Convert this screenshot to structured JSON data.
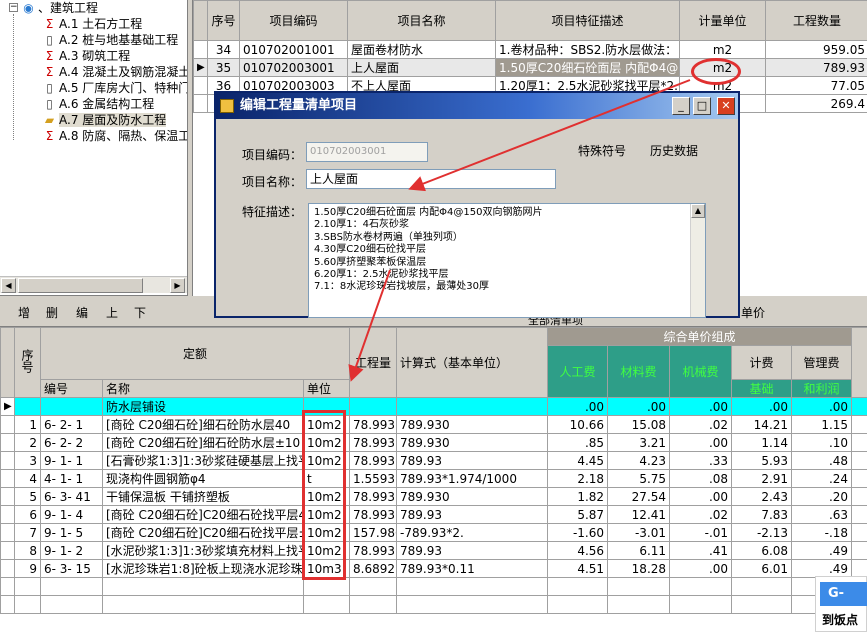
{
  "tree": {
    "root_label": "、建筑工程",
    "items": [
      {
        "icon": "sigma",
        "label": "A.1 土石方工程"
      },
      {
        "icon": "doc",
        "label": "A.2 桩与地基基础工程"
      },
      {
        "icon": "sigma",
        "label": "A.3 砌筑工程"
      },
      {
        "icon": "sigma",
        "label": "A.4 混凝土及钢筋混凝土"
      },
      {
        "icon": "doc",
        "label": "A.5 厂库房大门、特种门"
      },
      {
        "icon": "doc",
        "label": "A.6 金属结构工程"
      },
      {
        "icon": "folder",
        "label": "A.7 屋面及防水工程"
      },
      {
        "icon": "sigma",
        "label": "A.8 防腐、隔热、保温工"
      }
    ]
  },
  "toolbar": {
    "add": "增",
    "delete": "删",
    "edit": "编",
    "up": "上",
    "down": "下"
  },
  "top_grid": {
    "headers": [
      "序号",
      "项目编码",
      "项目名称",
      "项目特征描述",
      "计量单位",
      "工程数量"
    ],
    "rows": [
      {
        "seq": "34",
        "code": "010702001001",
        "name": "屋面卷材防水",
        "desc": "1.卷材品种：SBS2.防水层做法：",
        "unit": "m2",
        "qty": "959.05"
      },
      {
        "seq": "35",
        "code": "010702003001",
        "name": "上人屋面",
        "desc": "1.50厚C20细石砼面层 内配Φ4@1",
        "unit": "m2",
        "qty": "789.93"
      },
      {
        "seq": "36",
        "code": "010702003003",
        "name": "不上人屋面",
        "desc": "1.20厚1：2.5水泥砂浆找平层*2.(",
        "unit": "m2",
        "qty": "77.05"
      },
      {
        "seq": "",
        "code": "",
        "name": "",
        "desc": "",
        "unit": "",
        "qty": "269.4"
      }
    ]
  },
  "dialog": {
    "title": "编辑工程量清单项目",
    "code_label": "项目编码：",
    "code_value": "010702003001",
    "name_label": "项目名称：",
    "name_value": "上人屋面",
    "special_symbol": "特殊符号",
    "history": "历史数据",
    "desc_label": "特征描述：",
    "desc_lines": [
      "1.50厚C20细石砼面层 内配Φ4@150双向钢筋网片",
      "2.10厚1：4石灰砂浆",
      "3.SBS防水卷材两遍（单独列项）",
      "4.30厚C20细石砼找平层",
      "5.60厚挤塑聚苯板保温层",
      "6.20厚1：2.5水泥砂浆找平层",
      "7.1：8水泥珍珠岩找坡层，最薄处30厚"
    ]
  },
  "behind": {
    "unit_price": "单价",
    "all_list": "全部清单项"
  },
  "bottom_grid": {
    "h_seq": "序号",
    "h_quota": "定额",
    "h_code": "编号",
    "h_name": "名称",
    "h_unit": "单位",
    "h_qty": "工程量",
    "h_formula": "计算式（基本单位）",
    "h_comp": "综合单价组成",
    "h_labor": "人工费",
    "h_material": "材料费",
    "h_machine": "机械费",
    "h_fee": "计费",
    "h_base": "基础",
    "h_mgmt": "管理费",
    "h_profit": "和利润",
    "rows": [
      {
        "seq": "",
        "code": "",
        "name": "防水层铺设",
        "unit": "",
        "qty": "",
        "formula": "",
        "labor": ".00",
        "material": ".00",
        "machine": ".00",
        "base": ".00",
        "mgmt": ".00"
      },
      {
        "seq": "1",
        "code": "6- 2- 1",
        "name": "[商砼 C20细石砼]细石砼防水层40",
        "unit": "10m2",
        "qty": "78.993",
        "formula": "789.930",
        "labor": "10.66",
        "material": "15.08",
        "machine": ".02",
        "base": "14.21",
        "mgmt": "1.15"
      },
      {
        "seq": "2",
        "code": "6- 2- 2",
        "name": "[商砼 C20细石砼]细石砼防水层±10",
        "unit": "10m2",
        "qty": "78.993",
        "formula": "789.930",
        "labor": ".85",
        "material": "3.21",
        "machine": ".00",
        "base": "1.14",
        "mgmt": ".10"
      },
      {
        "seq": "3",
        "code": "9- 1- 1",
        "name": "[石膏砂浆1:3]1:3砂浆硅硬基层上找平",
        "unit": "10m2",
        "qty": "78.993",
        "formula": "789.93",
        "labor": "4.45",
        "material": "4.23",
        "machine": ".33",
        "base": "5.93",
        "mgmt": ".48"
      },
      {
        "seq": "4",
        "code": "4- 1- 1",
        "name": "现浇构件圆钢筋φ4",
        "unit": "t",
        "qty": "1.5593",
        "formula": "789.93*1.974/1000",
        "labor": "2.18",
        "material": "5.75",
        "machine": ".08",
        "base": "2.91",
        "mgmt": ".24"
      },
      {
        "seq": "5",
        "code": "6- 3- 41",
        "name": "干铺保温板 干铺挤塑板",
        "unit": "10m2",
        "qty": "78.993",
        "formula": "789.930",
        "labor": "1.82",
        "material": "27.54",
        "machine": ".00",
        "base": "2.43",
        "mgmt": ".20"
      },
      {
        "seq": "6",
        "code": "9- 1- 4",
        "name": "[商砼 C20细石砼]C20细石砼找平层4",
        "unit": "10m2",
        "qty": "78.993",
        "formula": "789.93",
        "labor": "5.87",
        "material": "12.41",
        "machine": ".02",
        "base": "7.83",
        "mgmt": ".63"
      },
      {
        "seq": "7",
        "code": "9- 1- 5",
        "name": "[商砼 C20细石砼]C20细石砼找平层±",
        "unit": "10m2",
        "qty": "157.986",
        "formula": "-789.93*2.",
        "labor": "-1.60",
        "material": "-3.01",
        "machine": "-.01",
        "base": "-2.13",
        "mgmt": "-.18"
      },
      {
        "seq": "8",
        "code": "9- 1- 2",
        "name": "[水泥砂浆1:3]1:3砂浆填充材料上找平",
        "unit": "10m2",
        "qty": "78.993",
        "formula": "789.93",
        "labor": "4.56",
        "material": "6.11",
        "machine": ".41",
        "base": "6.08",
        "mgmt": ".49"
      },
      {
        "seq": "9",
        "code": "6- 3- 15",
        "name": "[水泥珍珠岩1:8]砼板上现浇水泥珍珠岩",
        "unit": "10m3",
        "qty": "8.6892",
        "formula": "789.93*0.11",
        "labor": "4.51",
        "material": "18.28",
        "machine": ".00",
        "base": "6.01",
        "mgmt": ".49"
      }
    ]
  },
  "popup": {
    "badge": "G-",
    "text": "到饭点"
  },
  "colors": {
    "annotation": "#e03030",
    "teal": "#2e9e88",
    "cyan_row": "#00ffff",
    "title_bar": "#0a246a"
  }
}
